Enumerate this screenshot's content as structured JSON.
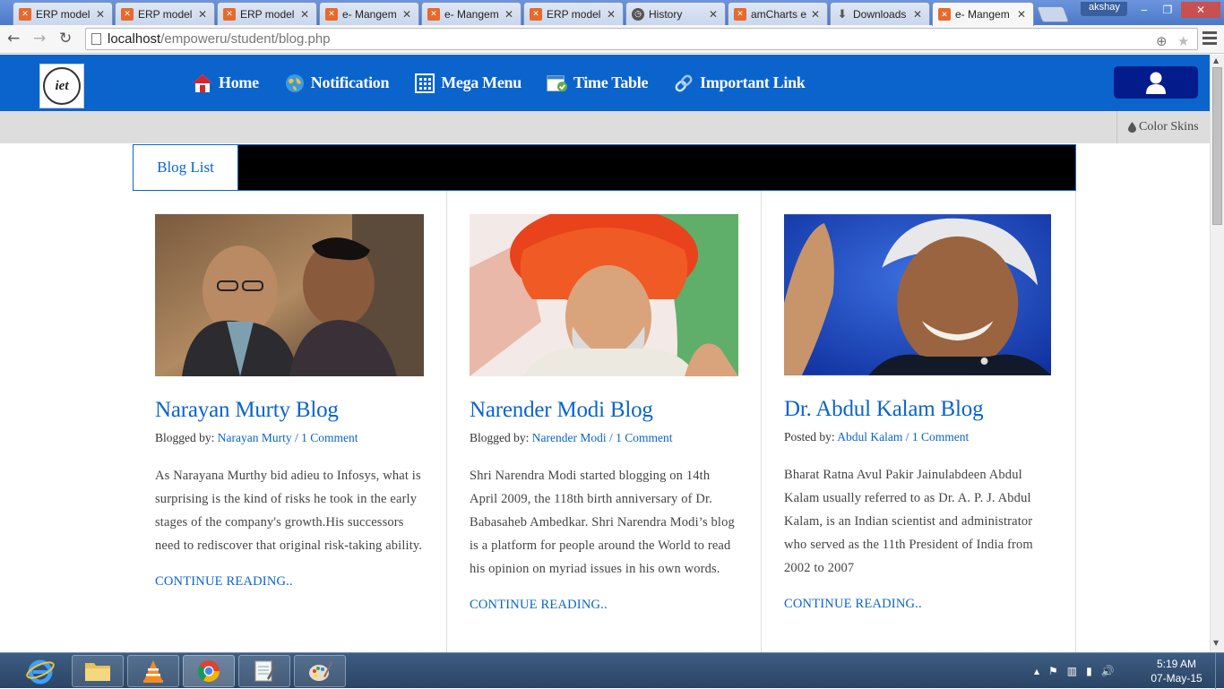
{
  "browser": {
    "tabs": [
      {
        "title": "ERP model",
        "icon": "xampp-icon",
        "active": false
      },
      {
        "title": "ERP model",
        "icon": "xampp-icon",
        "active": false
      },
      {
        "title": "ERP model",
        "icon": "xampp-icon",
        "active": false
      },
      {
        "title": "e- Mangem",
        "icon": "xampp-icon",
        "active": false
      },
      {
        "title": "e- Mangem",
        "icon": "xampp-icon",
        "active": false
      },
      {
        "title": "ERP model",
        "icon": "xampp-icon",
        "active": false
      },
      {
        "title": "History",
        "icon": "history-icon",
        "active": false
      },
      {
        "title": "amCharts e",
        "icon": "xampp-icon",
        "active": false
      },
      {
        "title": "Downloads",
        "icon": "download-icon",
        "active": false
      },
      {
        "title": "e- Mangem",
        "icon": "xampp-icon",
        "active": true
      }
    ],
    "profile_name": "akshay",
    "url_host": "localhost",
    "url_path": "/empoweru/student/blog.php"
  },
  "header": {
    "logo_text": "iet",
    "nav": [
      {
        "label": "Home",
        "icon": "home-icon"
      },
      {
        "label": "Notification",
        "icon": "globe-icon"
      },
      {
        "label": "Mega Menu",
        "icon": "grid-icon"
      },
      {
        "label": "Time Table",
        "icon": "calendar-icon"
      },
      {
        "label": "Important Link",
        "icon": "link-icon"
      }
    ]
  },
  "subbar": {
    "color_skins_label": "Color Skins"
  },
  "blog": {
    "tab_label": "Blog List",
    "posts": [
      {
        "title": "Narayan Murty Blog",
        "meta_prefix": "Blogged by:",
        "author": "Narayan Murty",
        "comments": "1 Comment",
        "body": "As Narayana Murthy bid adieu to Infosys, what is surprising is the kind of risks he took in the early stages of the company's growth.His successors need to rediscover that original risk-taking ability.",
        "more": "CONTINUE READING.."
      },
      {
        "title": "Narender Modi Blog",
        "meta_prefix": "Blogged by:",
        "author": "Narender Modi",
        "comments": "1 Comment",
        "body": "Shri Narendra Modi started blogging on 14th April 2009, the 118th birth anniversary of Dr. Babasaheb Ambedkar. Shri Narendra Modi’s blog is a platform for people around the World to read his opinion on myriad issues in his own words.",
        "more": "CONTINUE READING.."
      },
      {
        "title": "Dr. Abdul Kalam Blog",
        "meta_prefix": "Posted by:",
        "author": "Abdul Kalam",
        "comments": "1 Comment",
        "body": "Bharat Ratna Avul Pakir Jainulabdeen Abdul Kalam usually referred to as Dr. A. P. J. Abdul Kalam, is an Indian scientist and administrator who served as the 11th President of India from 2002 to 2007",
        "more": "CONTINUE READING.."
      }
    ]
  },
  "taskbar": {
    "time": "5:19 AM",
    "date": "07-May-15",
    "apps": [
      "internet-explorer-icon",
      "file-explorer-icon",
      "vlc-icon",
      "chrome-icon",
      "notepad-icon",
      "paint-icon"
    ]
  },
  "colors": {
    "brand_blue": "#0a64cc",
    "user_button": "#041b8c",
    "subbar_grey": "#dddddd"
  }
}
